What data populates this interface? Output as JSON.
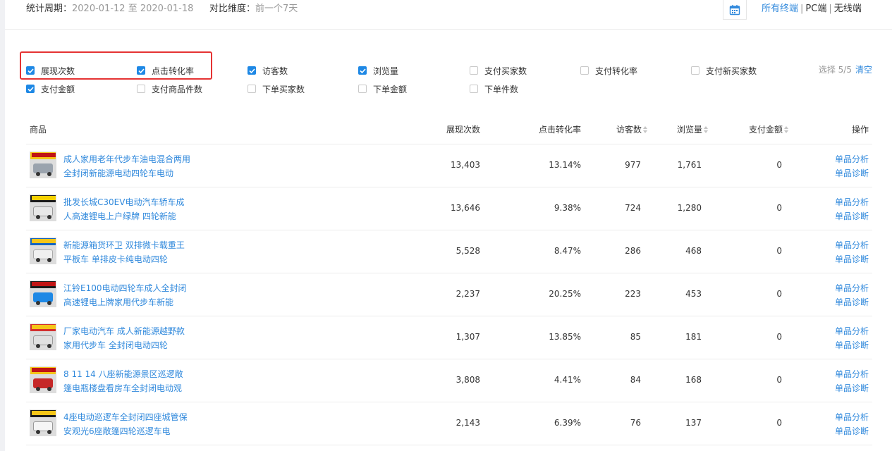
{
  "header": {
    "period_label": "统计周期：",
    "period_value": "2020-01-12 至 2020-01-18",
    "compare_label": "对比维度：",
    "compare_value": "前一个7天",
    "calendar_icon": "calendar-icon",
    "terminals": [
      "所有终端",
      "PC端",
      "无线端"
    ],
    "active_terminal": "所有终端",
    "separator": "|"
  },
  "metrics": {
    "items": [
      {
        "label": "展现次数",
        "checked": true
      },
      {
        "label": "点击转化率",
        "checked": true
      },
      {
        "label": "访客数",
        "checked": true
      },
      {
        "label": "浏览量",
        "checked": true
      },
      {
        "label": "支付买家数",
        "checked": false
      },
      {
        "label": "支付转化率",
        "checked": false
      },
      {
        "label": "支付新买家数",
        "checked": false
      },
      {
        "label": "支付金额",
        "checked": true
      },
      {
        "label": "支付商品件数",
        "checked": false
      },
      {
        "label": "下单买家数",
        "checked": false
      },
      {
        "label": "下单金额",
        "checked": false
      },
      {
        "label": "下单件数",
        "checked": false
      }
    ],
    "selected_text": "选择 5/5",
    "clear_label": "清空"
  },
  "table": {
    "headers": {
      "product": "商品",
      "exposure": "展现次数",
      "ctr": "点击转化率",
      "visitors": "访客数",
      "pageviews": "浏览量",
      "payment": "支付金额",
      "ops": "操作"
    },
    "op_labels": [
      "单品分析",
      "单品诊断"
    ],
    "rows": [
      {
        "name": "成人家用老年代步车油电混合两用全封闭新能源电动四轮车电动",
        "exposure": "13,403",
        "ctr": "13.14%",
        "visitors": "977",
        "pageviews": "1,761",
        "payment": "0"
      },
      {
        "name": "批发长城C30EV电动汽车轿车成人高速锂电上户绿牌 四轮新能",
        "exposure": "13,646",
        "ctr": "9.38%",
        "visitors": "724",
        "pageviews": "1,280",
        "payment": "0"
      },
      {
        "name": "新能源箱货环卫 双排微卡载重王平板车 单排皮卡纯电动四轮",
        "exposure": "5,528",
        "ctr": "8.47%",
        "visitors": "286",
        "pageviews": "468",
        "payment": "0"
      },
      {
        "name": "江铃E100电动四轮车成人全封闭高速锂电上牌家用代步车新能",
        "exposure": "2,237",
        "ctr": "20.25%",
        "visitors": "223",
        "pageviews": "453",
        "payment": "0"
      },
      {
        "name": "厂家电动汽车 成人新能源越野款家用代步车 全封闭电动四轮",
        "exposure": "1,307",
        "ctr": "13.85%",
        "visitors": "85",
        "pageviews": "181",
        "payment": "0"
      },
      {
        "name": "8 11 14 八座新能源景区巡逻敞篷电瓶楼盘看房车全封闭电动观",
        "exposure": "3,808",
        "ctr": "4.41%",
        "visitors": "84",
        "pageviews": "168",
        "payment": "0"
      },
      {
        "name": "4座电动巡逻车全封闭四座城管保安观光6座敞篷四轮巡逻车电",
        "exposure": "2,143",
        "ctr": "6.39%",
        "visitors": "76",
        "pageviews": "137",
        "payment": "0"
      }
    ]
  },
  "colors": {
    "link": "#3089dc",
    "checkbox": "#1e88e5",
    "highlight": "#e53333"
  }
}
